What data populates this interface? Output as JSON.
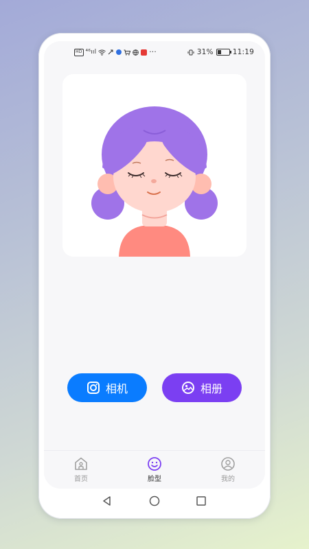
{
  "status_bar": {
    "battery_percent": "31%",
    "time": "11:19",
    "hd_label": "HD",
    "signal_label": "⁴⁶ııl",
    "more": "···"
  },
  "actions": {
    "camera_label": "相机",
    "album_label": "相册"
  },
  "tabs": [
    {
      "label": "首页",
      "icon": "home-icon",
      "active": false
    },
    {
      "label": "脸型",
      "icon": "face-icon",
      "active": true
    },
    {
      "label": "我的",
      "icon": "user-icon",
      "active": false
    }
  ],
  "colors": {
    "camera_button": "#0a7cff",
    "album_button": "#7b3ff2",
    "active_tab": "#7b3ff2",
    "hair": "#9f73e8",
    "skin": "#ffd7cf",
    "shirt": "#ff8a80"
  }
}
